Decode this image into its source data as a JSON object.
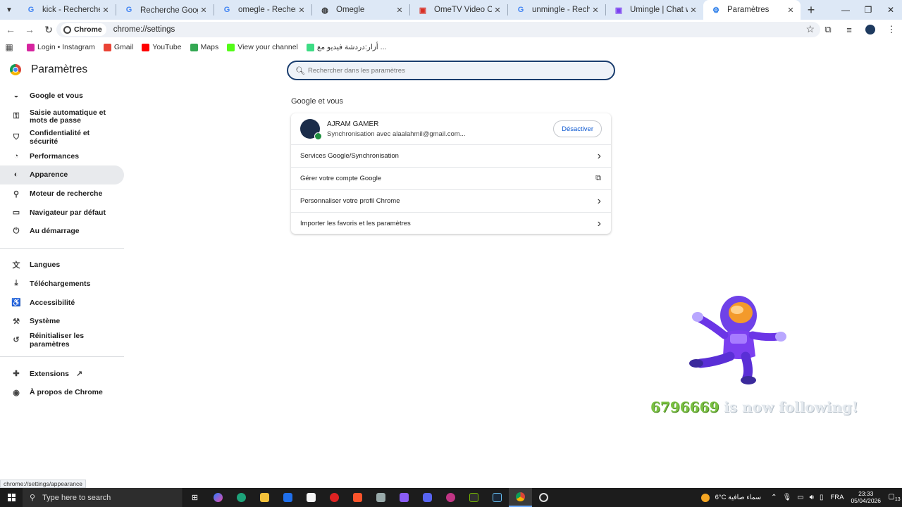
{
  "colors": {
    "tabstrip_bg": "#dde8f6",
    "accent_blue": "#0b57d0",
    "search_border": "#1a3d6e",
    "follower_green": "#7ac142",
    "taskbar_bg": "#1c1c1c"
  },
  "tabs": [
    {
      "title": "kick - Recherche Google",
      "icon": "google-icon",
      "active": false
    },
    {
      "title": "Recherche Google - ازار",
      "icon": "google-icon",
      "active": false
    },
    {
      "title": "omegle - Recherche Goog",
      "icon": "google-icon",
      "active": false
    },
    {
      "title": "Omegle",
      "icon": "globe-icon",
      "active": false
    },
    {
      "title": "OmeTV Video Chat — On",
      "icon": "ometv-icon",
      "active": false
    },
    {
      "title": "unmingle - Recherche Go",
      "icon": "google-icon",
      "active": false
    },
    {
      "title": "Umingle | Chat with Stran",
      "icon": "umingle-icon",
      "active": false
    },
    {
      "title": "Paramètres",
      "icon": "gear-icon",
      "active": true
    }
  ],
  "toolbar": {
    "chip_label": "Chrome",
    "url": "chrome://settings"
  },
  "bookmarks": [
    {
      "label": "Login • Instagram",
      "icon": "instagram-icon",
      "color": "#d6249f"
    },
    {
      "label": "Gmail",
      "icon": "gmail-icon",
      "color": "#ea4335"
    },
    {
      "label": "YouTube",
      "icon": "youtube-icon",
      "color": "#ff0000"
    },
    {
      "label": "Maps",
      "icon": "maps-icon",
      "color": "#34a853"
    },
    {
      "label": "View your channel",
      "icon": "kick-icon",
      "color": "#53fc18"
    },
    {
      "label": "أزار:دردشة فيديو مع ...",
      "icon": "azar-icon",
      "color": "#3ddc84"
    }
  ],
  "settings": {
    "title": "Paramètres",
    "search_placeholder": "Rechercher dans les paramètres",
    "nav_group1": [
      {
        "label": "Google et vous",
        "icon": "person-icon"
      },
      {
        "label": "Saisie automatique et mots de passe",
        "icon": "key-icon"
      },
      {
        "label": "Confidentialité et sécurité",
        "icon": "shield-icon"
      },
      {
        "label": "Performances",
        "icon": "speedometer-icon"
      },
      {
        "label": "Apparence",
        "icon": "palette-icon"
      },
      {
        "label": "Moteur de recherche",
        "icon": "search-icon"
      },
      {
        "label": "Navigateur par défaut",
        "icon": "browser-icon"
      },
      {
        "label": "Au démarrage",
        "icon": "power-icon"
      }
    ],
    "nav_group2": [
      {
        "label": "Langues",
        "icon": "translate-icon"
      },
      {
        "label": "Téléchargements",
        "icon": "download-icon"
      },
      {
        "label": "Accessibilité",
        "icon": "accessibility-icon"
      },
      {
        "label": "Système",
        "icon": "wrench-icon"
      },
      {
        "label": "Réinitialiser les paramètres",
        "icon": "reset-icon"
      }
    ],
    "nav_group3": [
      {
        "label": "Extensions",
        "icon": "puzzle-icon"
      },
      {
        "label": "À propos de Chrome",
        "icon": "chrome-icon"
      }
    ],
    "hovered_item": "Apparence"
  },
  "main": {
    "section_title": "Google et vous",
    "account": {
      "name": "AJRAM GAMER",
      "sync": "Synchronisation avec alaalahmil@gmail.com...",
      "disable_label": "Désactiver"
    },
    "rows": [
      {
        "label": "Services Google/Synchronisation",
        "icon": "chevron-right-icon"
      },
      {
        "label": "Gérer votre compte Google",
        "icon": "external-link-icon"
      },
      {
        "label": "Personnaliser votre profil Chrome",
        "icon": "chevron-right-icon"
      },
      {
        "label": "Importer les favoris et les paramètres",
        "icon": "chevron-right-icon"
      }
    ]
  },
  "overlay": {
    "follower_name": "6796669",
    "follow_text": "is now following!"
  },
  "status_url": "chrome://settings/appearance",
  "taskbar": {
    "search_placeholder": "Type here to search",
    "weather_temp": "6°C",
    "weather_desc": "سماء صافية",
    "language": "FRA",
    "time": "23:33",
    "date": "05/04/2026",
    "notification_count": "13"
  }
}
